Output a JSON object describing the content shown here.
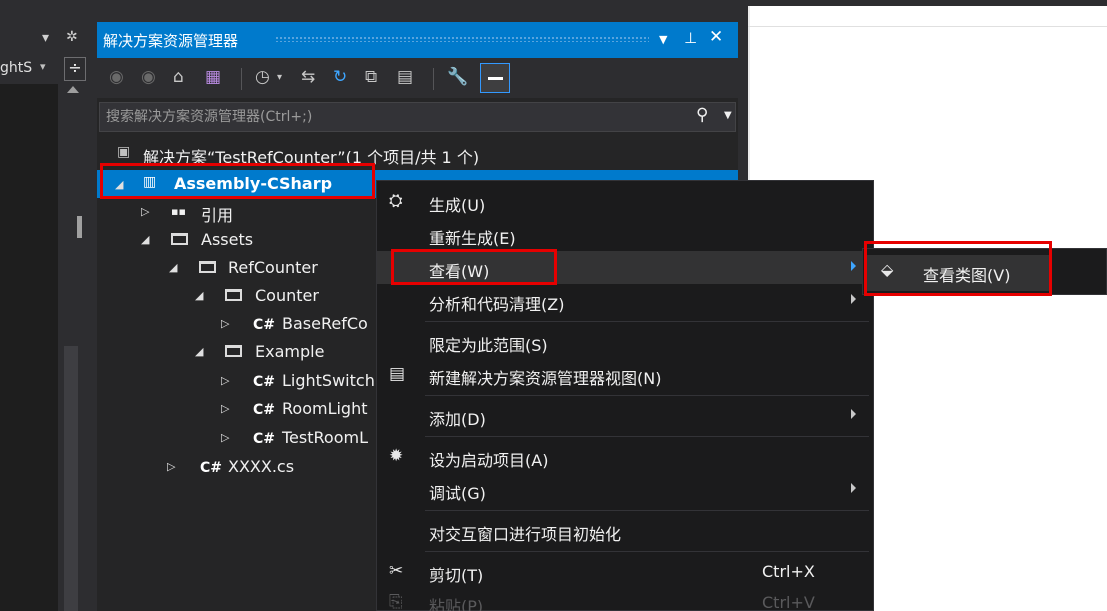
{
  "left_panel": {
    "truncated_text": "ghtS",
    "split_glyph": "÷"
  },
  "solution_explorer": {
    "title": "解决方案资源管理器",
    "search_placeholder": "搜索解决方案资源管理器(Ctrl+;)",
    "tree": {
      "solution": "解决方案“TestRefCounter”(1 个项目/共 1 个)",
      "project": "Assembly-CSharp",
      "references": "引用",
      "assets": "Assets",
      "refcounter": "RefCounter",
      "counter": "Counter",
      "baserefco": "BaseRefCo",
      "example": "Example",
      "lightswitch": "LightSwitch",
      "roomlight": "RoomLight",
      "testrooml": "TestRoomL",
      "xxxx": "XXXX.cs",
      "cs_badge": "C#"
    }
  },
  "context_menu": {
    "items": [
      {
        "label": "生成(U)"
      },
      {
        "label": "重新生成(E)"
      },
      {
        "label": "查看(W)"
      },
      {
        "label": "分析和代码清理(Z)"
      },
      {
        "label": "限定为此范围(S)"
      },
      {
        "label": "新建解决方案资源管理器视图(N)"
      },
      {
        "label": "添加(D)"
      },
      {
        "label": "设为启动项目(A)"
      },
      {
        "label": "调试(G)"
      },
      {
        "label": "对交互窗口进行项目初始化"
      },
      {
        "label": "剪切(T)",
        "shortcut": "Ctrl+X"
      },
      {
        "label": "粘贴(P)",
        "shortcut": "Ctrl+V"
      }
    ]
  },
  "submenu": {
    "label": "查看类图(V)"
  },
  "colors": {
    "accent": "#007acc",
    "highlight_border": "#e60000"
  }
}
